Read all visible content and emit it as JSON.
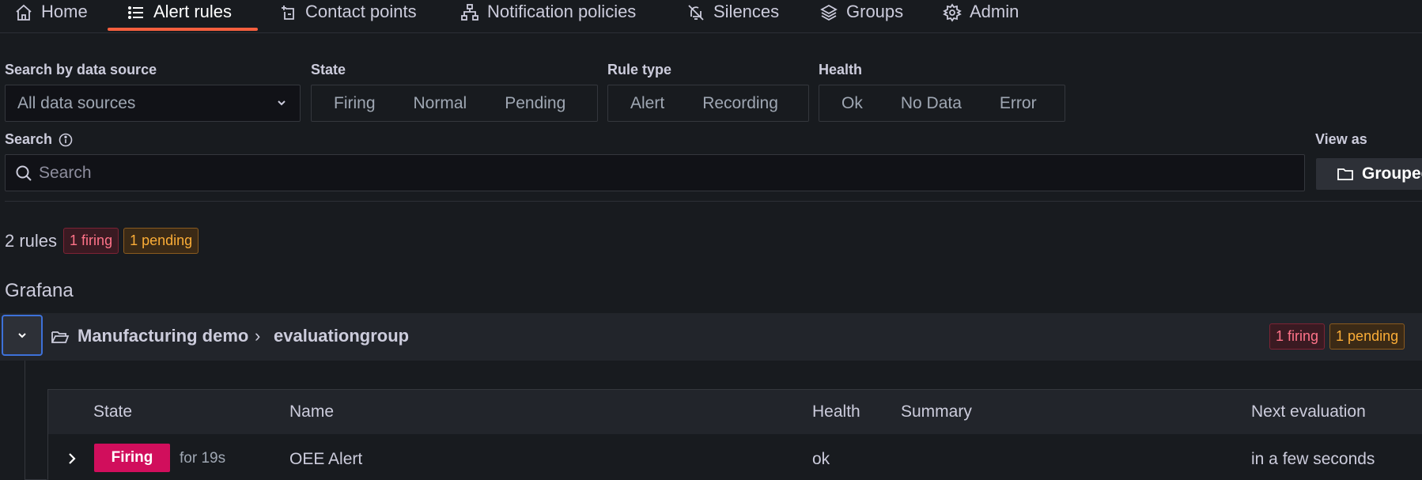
{
  "tabs": [
    {
      "label": "Home",
      "icon": "home-icon"
    },
    {
      "label": "Alert rules",
      "icon": "list-icon",
      "active": true
    },
    {
      "label": "Contact points",
      "icon": "contact-icon"
    },
    {
      "label": "Notification policies",
      "icon": "sitemap-icon"
    },
    {
      "label": "Silences",
      "icon": "bell-slash-icon"
    },
    {
      "label": "Groups",
      "icon": "layers-icon"
    },
    {
      "label": "Admin",
      "icon": "cog-icon"
    }
  ],
  "filters": {
    "datasource": {
      "label": "Search by data source",
      "value": "All data sources"
    },
    "state": {
      "label": "State",
      "options": [
        "Firing",
        "Normal",
        "Pending"
      ]
    },
    "rule_type": {
      "label": "Rule type",
      "options": [
        "Alert",
        "Recording"
      ]
    },
    "health": {
      "label": "Health",
      "options": [
        "Ok",
        "No Data",
        "Error"
      ]
    }
  },
  "search": {
    "label": "Search",
    "placeholder": "Search"
  },
  "view_as": {
    "label": "View as",
    "button": "Grouped"
  },
  "summary": {
    "count": "2 rules",
    "firing": "1 firing",
    "pending": "1 pending"
  },
  "section_title": "Grafana",
  "group": {
    "folder": "Manufacturing demo",
    "separator": "›",
    "name": "evaluationgroup",
    "firing": "1 firing",
    "pending": "1 pending"
  },
  "table": {
    "headers": [
      "State",
      "Name",
      "Health",
      "Summary",
      "Next evaluation"
    ],
    "rows": [
      {
        "state": "Firing",
        "for": "for 19s",
        "name": "OEE Alert",
        "health": "ok",
        "summary": "",
        "next_evaluation": "in a few seconds"
      }
    ]
  },
  "colors": {
    "accent": "#f55f3e",
    "firing": "#d10e5c",
    "pending": "#fbad37",
    "focus": "#3d71d9"
  }
}
